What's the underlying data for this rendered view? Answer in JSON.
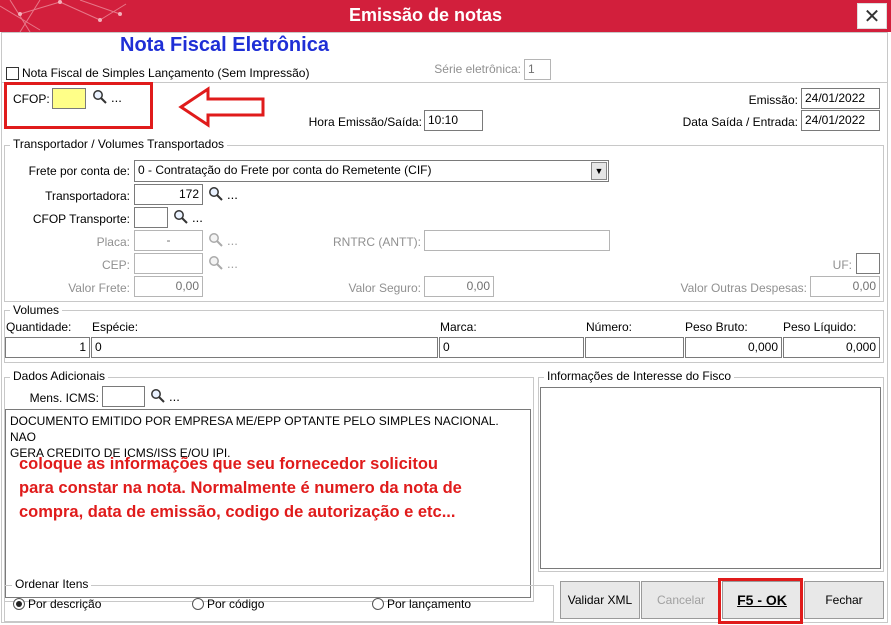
{
  "window": {
    "title": "Emissão de notas",
    "close_glyph": "✕",
    "heading": "Nota Fiscal Eletrônica"
  },
  "top": {
    "simples_checkbox_label": "Nota Fiscal de Simples Lançamento (Sem Impressão)",
    "simples_checked": false,
    "serie_label": "Série eletrônica:",
    "serie_value": "1",
    "cfop_label": "CFOP:",
    "cfop_value": "",
    "lookup_dots": "...",
    "emissao_label": "Emissão:",
    "emissao_value": "24/01/2022",
    "hora_label": "Hora Emissão/Saída:",
    "hora_value": "10:10",
    "data_saida_label": "Data Saída / Entrada:",
    "data_saida_value": "24/01/2022"
  },
  "transport": {
    "group_title": "Transportador /  Volumes Transportados",
    "frete_label": "Frete por conta de:",
    "frete_value": "0 - Contratação do Frete por conta do Remetente (CIF)",
    "transportadora_label": "Transportadora:",
    "transportadora_value": "172",
    "cfop_transp_label": "CFOP Transporte:",
    "cfop_transp_value": "",
    "placa_label": "Placa:",
    "placa_value": "-",
    "rntrc_label": "RNTRC (ANTT):",
    "rntrc_value": "",
    "cep_label": "CEP:",
    "cep_value": "",
    "uf_label": "UF:",
    "uf_value": "",
    "valor_frete_label": "Valor Frete:",
    "valor_frete_value": "0,00",
    "valor_seguro_label": "Valor Seguro:",
    "valor_seguro_value": "0,00",
    "valor_outras_label": "Valor Outras Despesas:",
    "valor_outras_value": "0,00"
  },
  "volumes": {
    "group_title": "Volumes",
    "headers": [
      "Quantidade:",
      "Espécie:",
      "Marca:",
      "Número:",
      "Peso Bruto:",
      "Peso Líquido:"
    ],
    "values": [
      "1",
      "0",
      "0",
      "",
      "0,000",
      "0,000"
    ]
  },
  "dados": {
    "group_title": "Dados Adicionais",
    "mens_icms_label": "Mens. ICMS:",
    "mens_icms_value": "",
    "text_line1": "DOCUMENTO EMITIDO POR EMPRESA ME/EPP OPTANTE PELO SIMPLES NACIONAL. NAO",
    "text_line2": "GERA CREDITO DE ICMS/ISS E/OU IPI.",
    "fisco_title": "Informações de Interesse do Fisco"
  },
  "annotation": {
    "line1": "coloque as informações que seu fornecedor solicitou",
    "line2": "para constar na nota. Normalmente é numero da nota de",
    "line3": "compra, data de emissão, codigo de autorização e etc...",
    "color": "#e01b1b"
  },
  "ordenar": {
    "group_title": "Ordenar Itens",
    "options": [
      "Por descrição",
      "Por código",
      "Por lançamento"
    ],
    "selected": "Por descrição"
  },
  "buttons": {
    "validar": "Validar XML",
    "cancelar": "Cancelar",
    "ok": "F5 - OK",
    "fechar": "Fechar"
  },
  "colors": {
    "titlebar": "#d21f3c",
    "heading": "#1f2fd6",
    "cfop_field": "#ffff88",
    "highlight_box": "#e01b1b"
  }
}
